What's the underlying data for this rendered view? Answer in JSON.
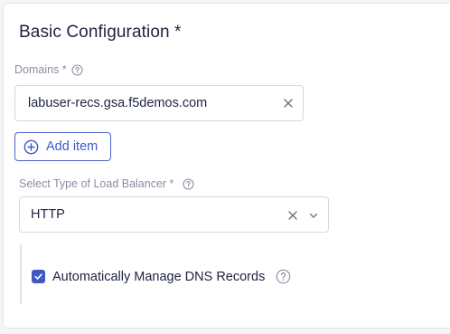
{
  "section": {
    "title": "Basic Configuration *"
  },
  "domains": {
    "label": "Domains *",
    "value": "labuser-recs.gsa.f5demos.com",
    "add_label": "Add item"
  },
  "load_balancer": {
    "label": "Select Type of Load Balancer *",
    "value": "HTTP"
  },
  "dns": {
    "checkbox_label": "Automatically Manage DNS Records",
    "checked": true
  },
  "colors": {
    "accent": "#3f5ac7",
    "border": "#d6d9e1",
    "label": "#8a8fa0",
    "text": "#1e2340"
  },
  "icons": {
    "help": "question-circle-icon",
    "clear": "close-icon",
    "add": "plus-circle-icon",
    "dropdown": "chevron-down-icon",
    "check": "check-icon"
  }
}
